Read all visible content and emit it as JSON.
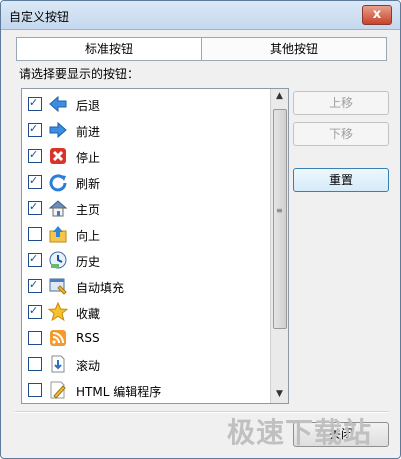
{
  "window": {
    "title": "自定义按钮",
    "close_symbol": "x"
  },
  "tabs": [
    {
      "label": "标准按钮",
      "active": true
    },
    {
      "label": "其他按钮",
      "active": false
    }
  ],
  "section": {
    "label": "请选择要显示的按钮："
  },
  "list": {
    "items": [
      {
        "label": "后退",
        "checked": true,
        "icon": "back-arrow-icon"
      },
      {
        "label": "前进",
        "checked": true,
        "icon": "forward-arrow-icon"
      },
      {
        "label": "停止",
        "checked": true,
        "icon": "stop-icon"
      },
      {
        "label": "刷新",
        "checked": true,
        "icon": "refresh-icon"
      },
      {
        "label": "主页",
        "checked": true,
        "icon": "home-icon"
      },
      {
        "label": "向上",
        "checked": false,
        "icon": "up-folder-icon"
      },
      {
        "label": "历史",
        "checked": true,
        "icon": "history-icon"
      },
      {
        "label": "自动填充",
        "checked": true,
        "icon": "autofill-icon"
      },
      {
        "label": "收藏",
        "checked": true,
        "icon": "favorites-star-icon"
      },
      {
        "label": "RSS",
        "checked": false,
        "icon": "rss-icon"
      },
      {
        "label": "滚动",
        "checked": false,
        "icon": "scroll-icon"
      },
      {
        "label": "HTML 编辑程序",
        "checked": false,
        "icon": "html-editor-icon"
      }
    ]
  },
  "buttons": {
    "move_up": "上移",
    "move_down": "下移",
    "reset": "重置",
    "close": "关闭"
  },
  "watermark": "极速下载站",
  "colors": {
    "accent": "#3c7fb1",
    "check": "#1e4f96",
    "title_bg": "#c5d8ee"
  }
}
